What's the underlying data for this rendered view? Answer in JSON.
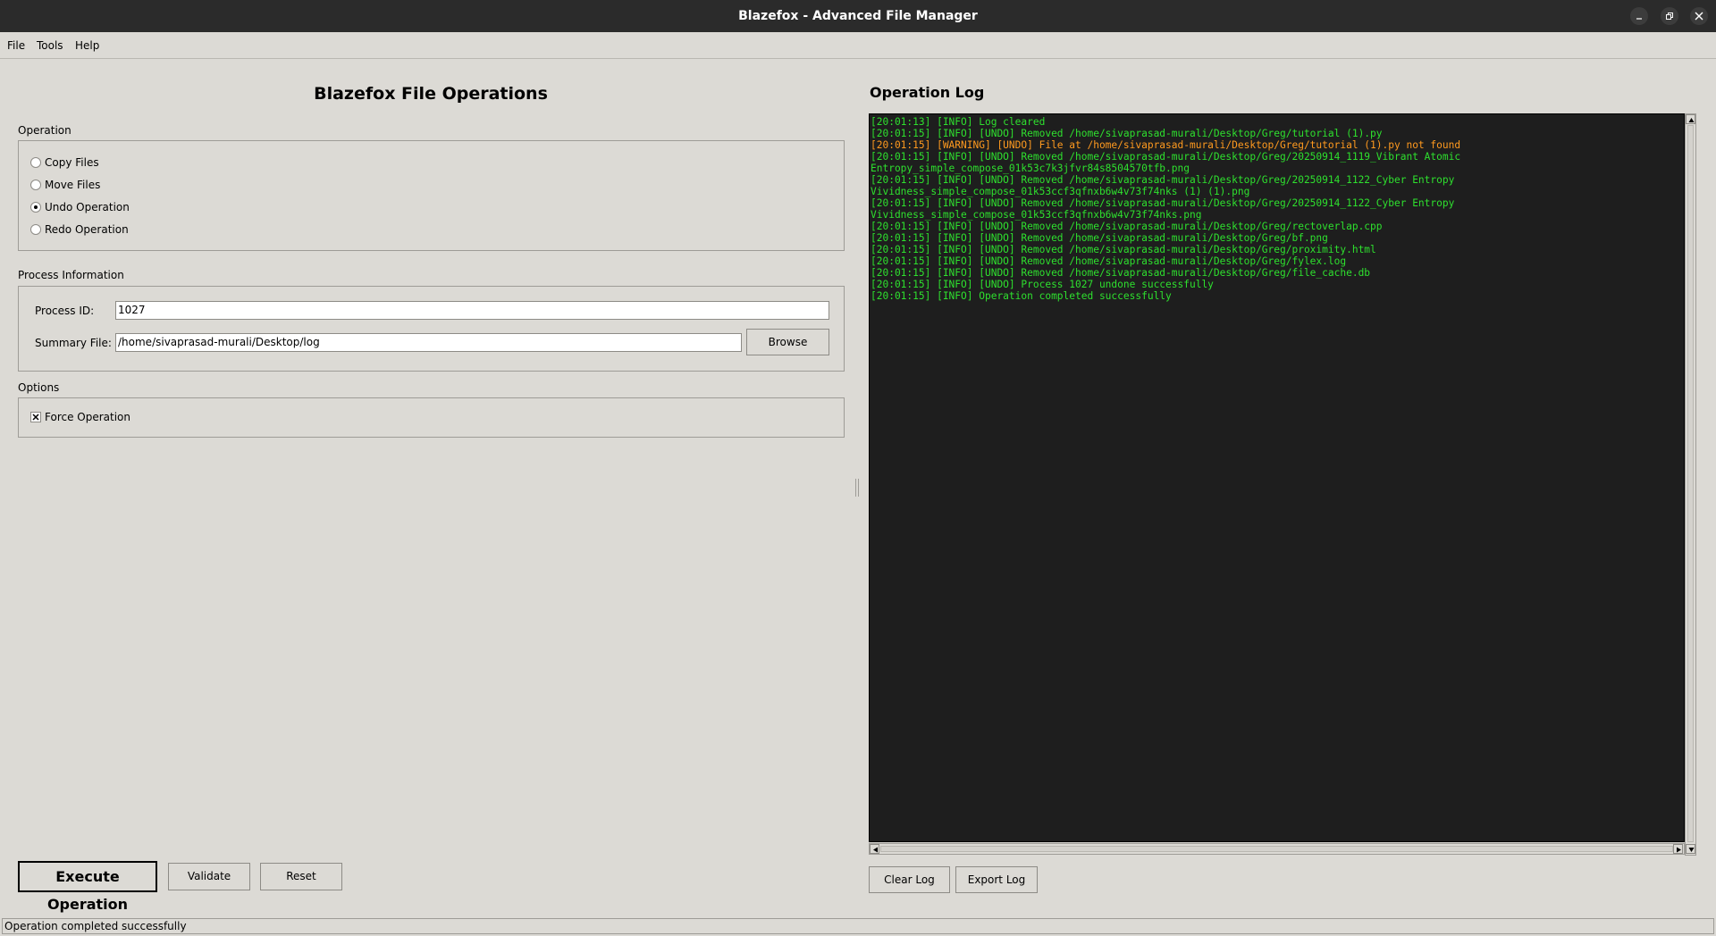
{
  "window": {
    "title": "Blazefox - Advanced File Manager"
  },
  "menu": {
    "items": [
      "File",
      "Tools",
      "Help"
    ]
  },
  "main": {
    "heading": "Blazefox File Operations",
    "operation": {
      "label": "Operation",
      "options": [
        "Copy Files",
        "Move Files",
        "Undo Operation",
        "Redo Operation"
      ],
      "selected": "Undo Operation"
    },
    "process": {
      "label": "Process Information",
      "pid_label": "Process ID:",
      "pid_value": "1027",
      "summary_label": "Summary File:",
      "summary_value": "/home/sivaprasad-murali/Desktop/log",
      "browse_label": "Browse"
    },
    "options": {
      "label": "Options",
      "force_label": "Force Operation",
      "force_checked": true
    },
    "buttons": {
      "execute": "Execute Operation",
      "validate": "Validate",
      "reset": "Reset"
    }
  },
  "log": {
    "title": "Operation Log",
    "lines": [
      {
        "text": "[20:01:13] [INFO] Log cleared",
        "level": "info"
      },
      {
        "text": "[20:01:15] [INFO] [UNDO] Removed /home/sivaprasad-murali/Desktop/Greg/tutorial (1).py",
        "level": "info"
      },
      {
        "text": "[20:01:15] [WARNING] [UNDO] File at /home/sivaprasad-murali/Desktop/Greg/tutorial (1).py not found",
        "level": "warning"
      },
      {
        "text": "[20:01:15] [INFO] [UNDO] Removed /home/sivaprasad-murali/Desktop/Greg/20250914_1119_Vibrant Atomic",
        "level": "info"
      },
      {
        "text": "Entropy_simple_compose_01k53c7k3jfvr84s8504570tfb.png",
        "level": "info"
      },
      {
        "text": "[20:01:15] [INFO] [UNDO] Removed /home/sivaprasad-murali/Desktop/Greg/20250914_1122_Cyber Entropy",
        "level": "info"
      },
      {
        "text": "Vividness_simple_compose_01k53ccf3qfnxb6w4v73f74nks (1) (1).png",
        "level": "info"
      },
      {
        "text": "[20:01:15] [INFO] [UNDO] Removed /home/sivaprasad-murali/Desktop/Greg/20250914_1122_Cyber Entropy",
        "level": "info"
      },
      {
        "text": "Vividness_simple_compose_01k53ccf3qfnxb6w4v73f74nks.png",
        "level": "info"
      },
      {
        "text": "[20:01:15] [INFO] [UNDO] Removed /home/sivaprasad-murali/Desktop/Greg/rectoverlap.cpp",
        "level": "info"
      },
      {
        "text": "[20:01:15] [INFO] [UNDO] Removed /home/sivaprasad-murali/Desktop/Greg/bf.png",
        "level": "info"
      },
      {
        "text": "[20:01:15] [INFO] [UNDO] Removed /home/sivaprasad-murali/Desktop/Greg/proximity.html",
        "level": "info"
      },
      {
        "text": "[20:01:15] [INFO] [UNDO] Removed /home/sivaprasad-murali/Desktop/Greg/fylex.log",
        "level": "info"
      },
      {
        "text": "[20:01:15] [INFO] [UNDO] Removed /home/sivaprasad-murali/Desktop/Greg/file_cache.db",
        "level": "info"
      },
      {
        "text": "[20:01:15] [INFO] [UNDO] Process 1027 undone successfully",
        "level": "info"
      },
      {
        "text": "[20:01:15] [INFO] Operation completed successfully",
        "level": "info"
      }
    ],
    "clear_label": "Clear Log",
    "export_label": "Export Log"
  },
  "status": {
    "text": "Operation completed successfully"
  },
  "colors": {
    "info": "#2ee02e",
    "warning": "#ff9a1f",
    "log_bg": "#1e1e1e",
    "window_bg": "#dcdad5"
  }
}
